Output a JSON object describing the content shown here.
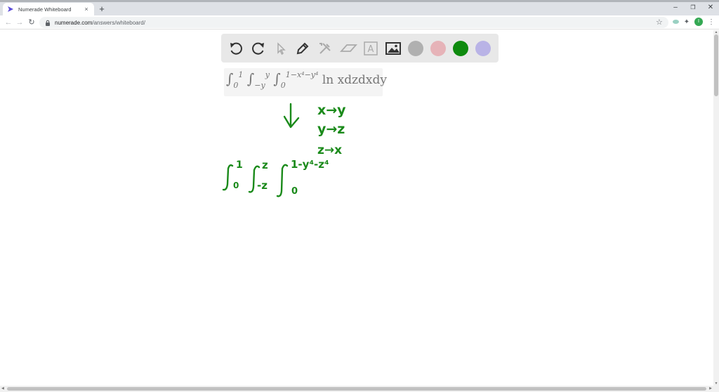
{
  "browser": {
    "tab_title": "Numerade Whiteboard",
    "tab_close": "×",
    "new_tab": "+",
    "minimize": "–",
    "restore": "❐",
    "close": "✕",
    "url_host": "numerade.com",
    "url_path": "/answers/whiteboard/",
    "bookmark_star": "☆",
    "avatar_letter": "I"
  },
  "whiteboard": {
    "swatches": [
      {
        "name": "gray",
        "color": "#b0b0b0"
      },
      {
        "name": "pink",
        "color": "#e6b3b8"
      },
      {
        "name": "green",
        "color": "#0e8a0e"
      },
      {
        "name": "lavender",
        "color": "#b9b3e6"
      }
    ],
    "math": {
      "int1_lower": "0",
      "int1_upper": "1",
      "int2_lower": "−y",
      "int2_upper": "y",
      "int3_lower": "0",
      "int3_upper": "1−x⁴−y⁴",
      "integrand": "ln xdzdxdy"
    },
    "handwriting": {
      "sub1": "x→y",
      "sub2": "y→z",
      "sub3": "z→x",
      "int1_upper": "1",
      "int1_lower": "0",
      "int2_upper": "z",
      "int2_lower": "-z",
      "int3_lower": "0",
      "int3_upper": "1-y⁴-z⁴"
    }
  }
}
